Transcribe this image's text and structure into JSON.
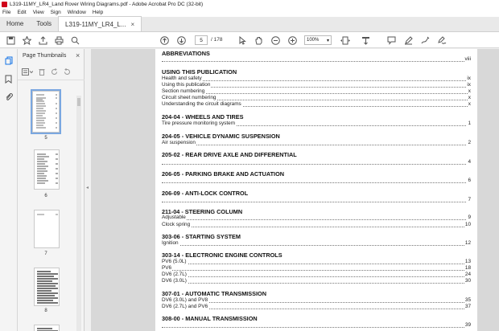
{
  "window": {
    "title": "L319-11MY_LR4_Land Rover Wiring Diagrams.pdf - Adobe Acrobat Pro DC (32-bit)"
  },
  "menu": [
    "File",
    "Edit",
    "View",
    "Sign",
    "Window",
    "Help"
  ],
  "tabs": {
    "home": "Home",
    "tools": "Tools",
    "doc": "L319-11MY_LR4_L...",
    "close": "×"
  },
  "toolbar": {
    "page_current": "5",
    "page_total": "/ 178",
    "zoom": "100%"
  },
  "panel": {
    "title": "Page Thumbnails",
    "close": "×",
    "thumb_labels": [
      "5",
      "6",
      "7",
      "8"
    ]
  },
  "toc": {
    "abbrev": {
      "title": "ABBREVIATIONS",
      "page": "viii"
    },
    "using": {
      "title": "USING THIS PUBLICATION",
      "items": [
        {
          "label": "Health and safety",
          "page": "ix"
        },
        {
          "label": "Using this publication",
          "page": "ix"
        },
        {
          "label": "Section numbering",
          "page": "x"
        },
        {
          "label": "Circuit sheet numbering",
          "page": "x"
        },
        {
          "label": "Understanding the circuit diagrams",
          "page": "x"
        }
      ]
    },
    "s1": {
      "title": "204-04 - WHEELS AND TIRES",
      "items": [
        {
          "label": "Tire pressure monitoring system",
          "page": "1"
        }
      ]
    },
    "s2": {
      "title": "204-05 - VEHICLE DYNAMIC SUSPENSION",
      "items": [
        {
          "label": "Air suspension",
          "page": "2"
        }
      ]
    },
    "s3": {
      "title": "205-02 - REAR DRIVE AXLE AND DIFFERENTIAL",
      "page": "4"
    },
    "s4": {
      "title": "206-05 - PARKING BRAKE AND ACTUATION",
      "page": "6"
    },
    "s5": {
      "title": "206-09 - ANTI-LOCK CONTROL",
      "page": "7"
    },
    "s6": {
      "title": "211-04 - STEERING COLUMN",
      "items": [
        {
          "label": "Adjustable",
          "page": "9"
        },
        {
          "label": "Clock spring",
          "page": "10"
        }
      ]
    },
    "s7": {
      "title": "303-06 - STARTING SYSTEM",
      "items": [
        {
          "label": "Ignition",
          "page": "12"
        }
      ]
    },
    "s8": {
      "title": "303-14 - ELECTRONIC ENGINE CONTROLS",
      "items": [
        {
          "label": "PV6 (5.0L)",
          "page": "13"
        },
        {
          "label": "PV6",
          "page": "18"
        },
        {
          "label": "DV6 (2.7L)",
          "page": "24"
        },
        {
          "label": "DV6 (3.0L)",
          "page": "30"
        }
      ]
    },
    "s9": {
      "title": "307-01 - AUTOMATIC TRANSMISSION",
      "items": [
        {
          "label": "DV6 (3.0L) and PV8",
          "page": "35"
        },
        {
          "label": "DV6 (2.7L) and PV6",
          "page": "37"
        }
      ]
    },
    "s10": {
      "title": "308-00 - MANUAL TRANSMISSION",
      "page": "39"
    }
  }
}
